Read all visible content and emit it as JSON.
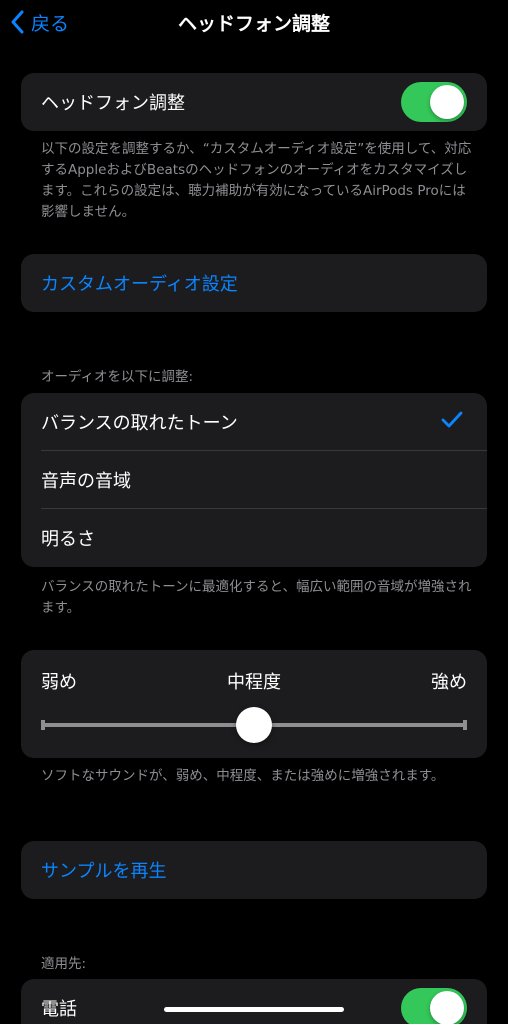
{
  "nav": {
    "back_label": "戻る",
    "title": "ヘッドフォン調整"
  },
  "main_toggle": {
    "label": "ヘッドフォン調整",
    "on": true
  },
  "main_note": "以下の設定を調整するか、“カスタムオーディオ設定”を使用して、対応するAppleおよびBeatsのヘッドフォンのオーディオをカスタマイズします。これらの設定は、聴力補助が有効になっているAirPods Proには影響しません。",
  "custom_audio_label": "カスタムオーディオ設定",
  "tune_header": "オーディオを以下に調整:",
  "tune_options": [
    {
      "label": "バランスの取れたトーン",
      "selected": true
    },
    {
      "label": "音声の音域",
      "selected": false
    },
    {
      "label": "明るさ",
      "selected": false
    }
  ],
  "tune_note": "バランスの取れたトーンに最適化すると、幅広い範囲の音域が増強されます。",
  "strength": {
    "low_label": "弱め",
    "mid_label": "中程度",
    "high_label": "強め",
    "value_fraction": 0.5
  },
  "strength_note": "ソフトなサウンドが、弱め、中程度、または強めに増強されます。",
  "play_sample_label": "サンプルを再生",
  "apply_header": "適用先:",
  "apply_rows": [
    {
      "label": "電話",
      "on": true
    }
  ],
  "colors": {
    "accent": "#0a84ff",
    "toggle_on": "#34c759",
    "background": "#000000",
    "cell": "#1c1c1e",
    "secondary_text": "#8e8e93"
  }
}
